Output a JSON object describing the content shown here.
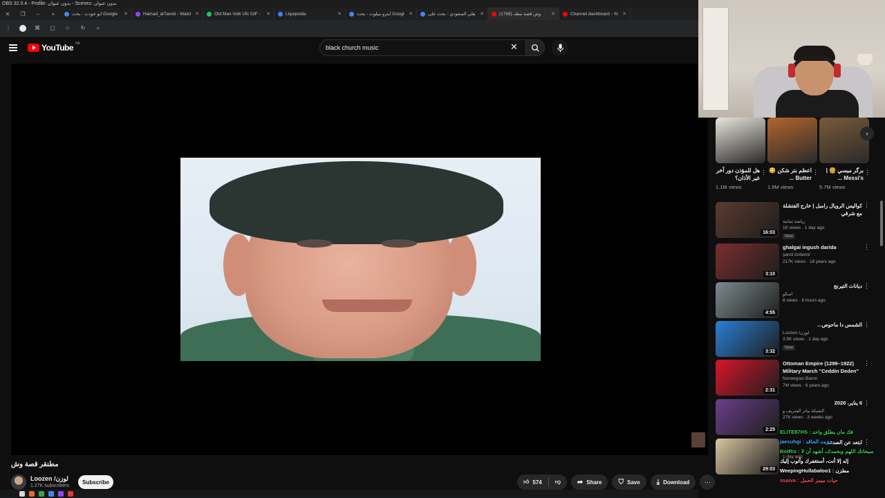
{
  "obs": {
    "title": "OBS 32.0.4 - Profile: بدون عنوان - Scenes: بدون عنوان"
  },
  "browser": {
    "tabs": [
      {
        "label": "ابو جودت - بحث Google",
        "color": "#4285f4"
      },
      {
        "label": "Hamad_al7anoti - Watch",
        "color": "#9146ff"
      },
      {
        "label": "Old Man Volk Ufc GIF - Gi",
        "color": "#22c55e"
      },
      {
        "label": "Liquipedia",
        "color": "#3b82f6"
      },
      {
        "label": "اينزو ميلوت - بحث Google",
        "color": "#4285f4"
      },
      {
        "label": "الاهلي السعودي - بحث على",
        "color": "#4285f4"
      },
      {
        "label": "(1768) وش قصة مطنـ",
        "color": "#ff0000"
      },
      {
        "label": "Channel dashboard - You",
        "color": "#ff0000"
      }
    ]
  },
  "youtube": {
    "logo_text": "YouTube",
    "country": "SA",
    "search_value": "black church music"
  },
  "video": {
    "title": "مطنقر قصة وش",
    "channel": "Loozen /لوزن",
    "subscribers": "1.27K subscribers",
    "subscribe_label": "Subscribe",
    "likes": "574",
    "share_label": "Share",
    "save_label": "Save",
    "download_label": "Download"
  },
  "shorts": [
    {
      "title": "هل للمؤذن دور آخر غير الأذان؟",
      "views": "1.1M views",
      "color": "#e9e4dc"
    },
    {
      "title": "اعظم بتر شكن 😋 Butter ...",
      "views": "1.9M views",
      "color": "#b3652c"
    },
    {
      "title": "برگر ميسي 🍔 | Messi's ...",
      "views": "5.7M views",
      "color": "#7a5a3a"
    }
  ],
  "recommended": [
    {
      "title": "كواليس الرويال رامبل | خارج الفتشلة مع شرقي",
      "channel": "رياضة ثمانية",
      "meta": "1K views · 1 day ago",
      "badge": "New",
      "duration": "16:03",
      "color": "#5b3b2e"
    },
    {
      "title": "ghalgai ingush darida",
      "channel": "şamil özdemir",
      "meta": "217K views · 18 years ago",
      "badge": "",
      "duration": "3:10",
      "color": "#7a2e2e"
    },
    {
      "title": "ديانات التيرنج",
      "channel": "اسكو",
      "meta": "8 views · 8 hours ago",
      "badge": "",
      "duration": "4:55",
      "color": "#7c8a8e"
    },
    {
      "title": "الشمس دا ماحوص...",
      "channel": "Loozen /لوزن",
      "meta": "3.9K views · 1 day ago",
      "badge": "New",
      "duration": "3:32",
      "color": "#2b7fd6"
    },
    {
      "title": "Ottoman Empire (1299–1922) Military March \"Ceddin Deden\"",
      "channel": "Norwegian Baron",
      "meta": "7M views · 6 years ago",
      "badge": "",
      "duration": "2:31",
      "color": "#d6152a"
    },
    {
      "title": "6 يناير، 2026",
      "channel": "الشبكة بيانر الشريف و",
      "meta": "27K views · 3 weeks ago",
      "badge": "",
      "duration": "2:25",
      "color": "#6a3f8a"
    },
    {
      "title": "ابتعد عن الصدمة",
      "channel": "",
      "meta": "1 day ago",
      "badge": "",
      "duration": "29:03",
      "color": "#d9c6a2"
    }
  ],
  "chat": [
    {
      "text": "ELITE87HS : فك مان يطلق واحد",
      "color": "#39d353"
    },
    {
      "text": "jaesuhgi : جريت الحاقد",
      "color": "#4aa8ff"
    },
    {
      "text": "BotRix : سبحانك اللهم وبحمدك، أشهد أن لا",
      "color": "#39d353"
    },
    {
      "text": "إله إلا أنت، أستغفرك وأتوب إليك",
      "color": "#ffffff"
    },
    {
      "text": "WeepingHullabaloo1 : مطزن",
      "color": "#ffffff"
    },
    {
      "text": "ssaiva : حيات ميمز الحمل",
      "color": "#ff4d4d"
    }
  ]
}
